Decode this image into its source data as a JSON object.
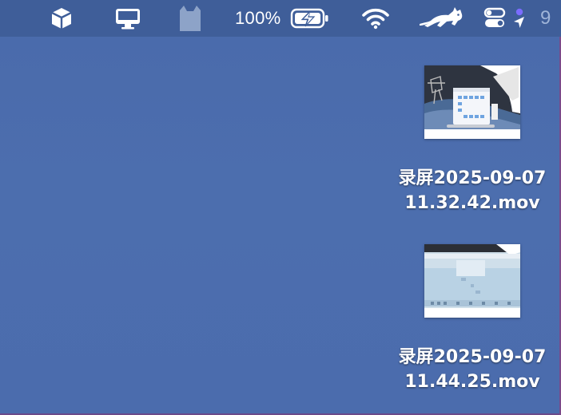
{
  "menubar": {
    "items": [
      {
        "icon": "box-icon"
      },
      {
        "icon": "display-icon"
      },
      {
        "icon": "cat-tag-icon"
      },
      {
        "icon": "battery-charging-icon"
      },
      {
        "icon": "wifi-icon"
      },
      {
        "icon": "runcat-icon"
      },
      {
        "icon": "control-center-icon"
      },
      {
        "icon": "location-arrow-icon"
      }
    ],
    "battery_percent": "100%",
    "clock_partial": "9",
    "status_dot_color": "#7b6cff"
  },
  "desktop": {
    "background_color": "#4b6dad",
    "files": [
      {
        "name_line1": "录屏2025-09-07",
        "name_line2": "11.32.42.mov",
        "icon": "video-thumbnail-icon"
      },
      {
        "name_line1": "录屏2025-09-07",
        "name_line2": "11.44.25.mov",
        "icon": "video-thumbnail-icon"
      }
    ]
  }
}
